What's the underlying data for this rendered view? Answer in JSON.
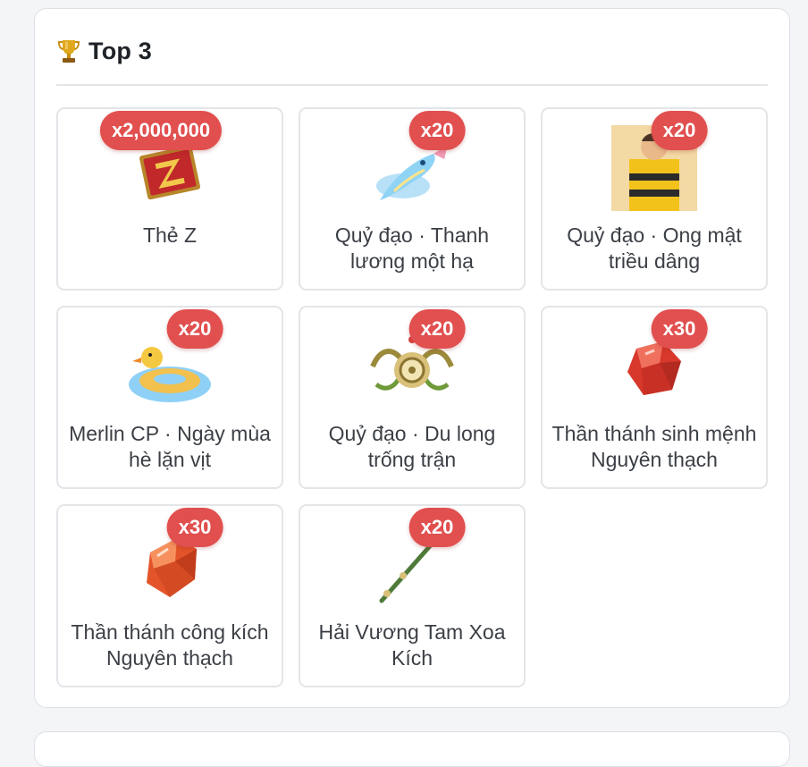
{
  "section": {
    "title": "Top 3",
    "icon": "trophy-icon"
  },
  "colors": {
    "badge": "#e14f4f",
    "card_border": "#e3e5e8",
    "text": "#3b3f45"
  },
  "items": [
    {
      "name": "Thẻ Z",
      "quantity": "x2,000,000",
      "icon": "z-card-icon"
    },
    {
      "name": "Quỷ đạo · Thanh lương một hạ",
      "quantity": "x20",
      "icon": "fish-trail-icon"
    },
    {
      "name": "Quỷ đạo · Ong mật triều dâng",
      "quantity": "x20",
      "icon": "bee-costume-icon"
    },
    {
      "name": "Merlin CP · Ngày mùa hè lặn vịt",
      "quantity": "x20",
      "icon": "duck-float-icon"
    },
    {
      "name": "Quỷ đạo · Du long trống trận",
      "quantity": "x20",
      "icon": "war-drum-icon"
    },
    {
      "name": "Thần thánh sinh mệnh Nguyên thạch",
      "quantity": "x30",
      "icon": "red-gem-icon"
    },
    {
      "name": "Thần thánh công kích Nguyên thạch",
      "quantity": "x30",
      "icon": "orange-gem-icon"
    },
    {
      "name": "Hải Vương Tam Xoa Kích",
      "quantity": "x20",
      "icon": "trident-icon"
    }
  ]
}
